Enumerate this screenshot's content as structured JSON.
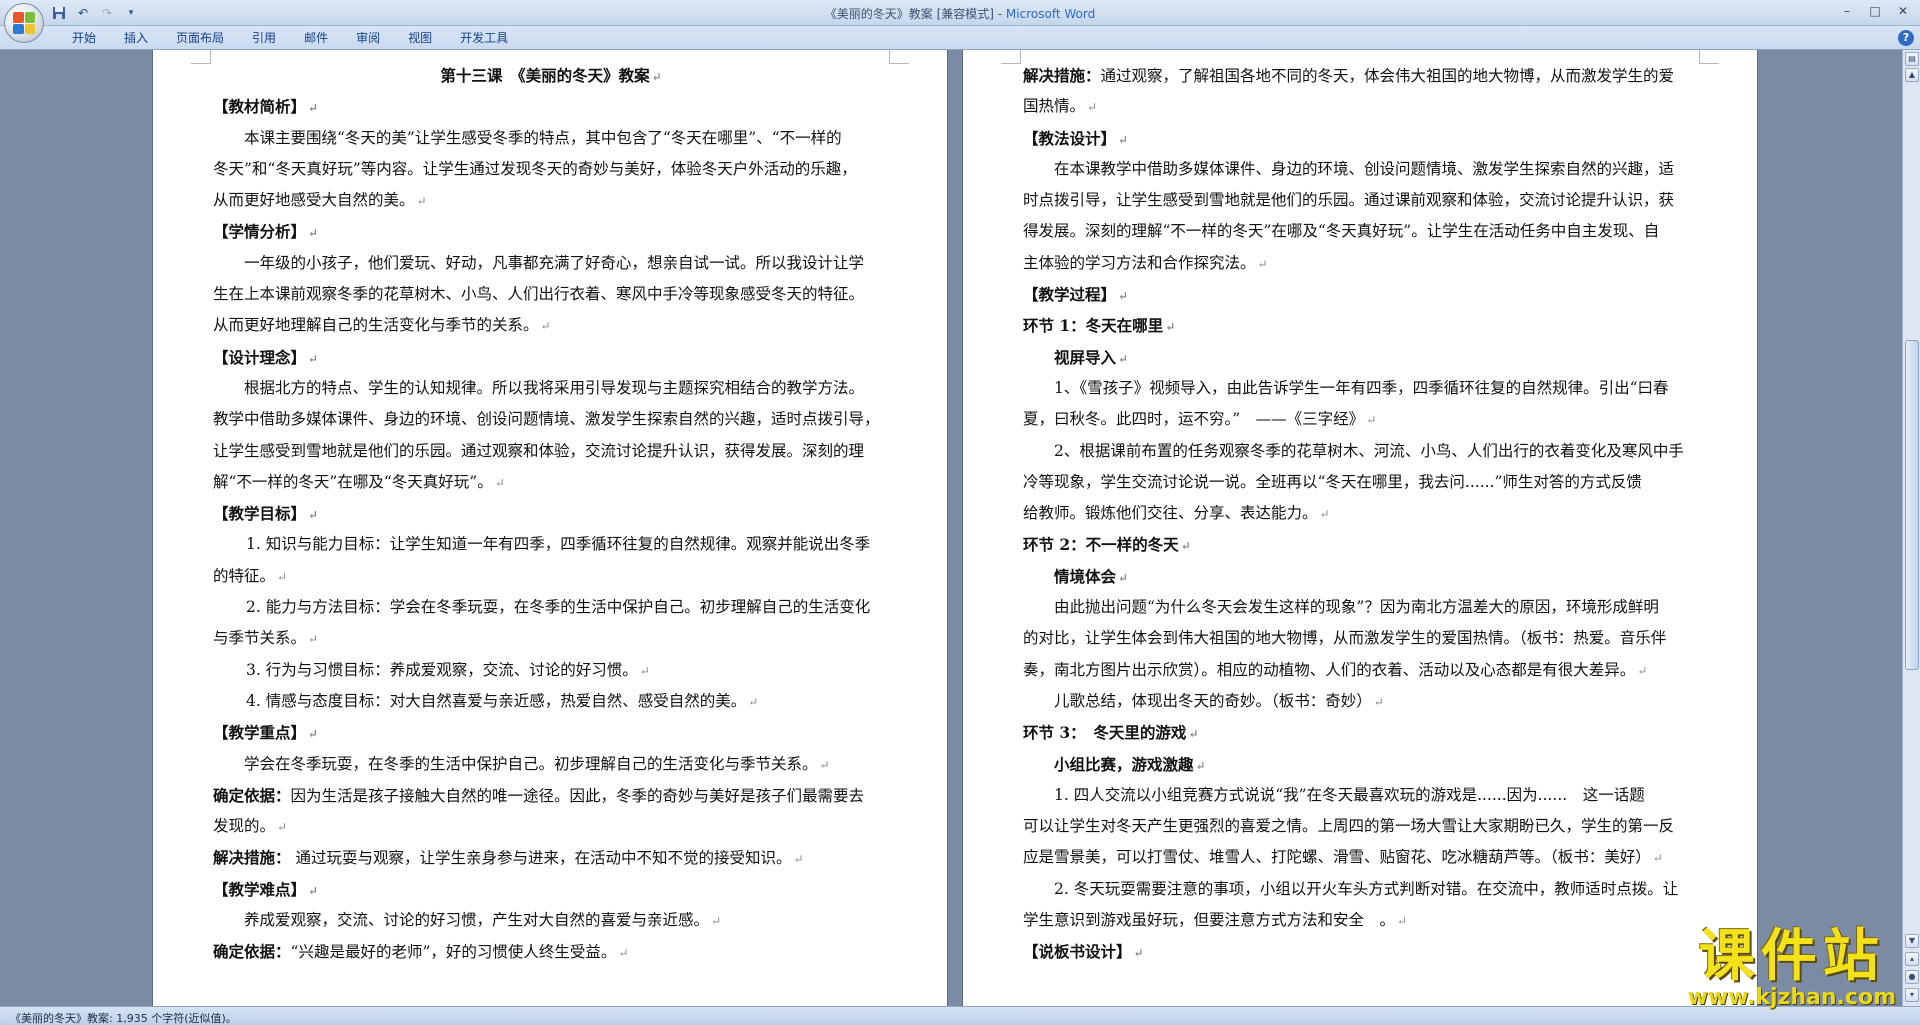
{
  "window": {
    "title": "《美丽的冬天》教案 [兼容模式] - ",
    "app_name": "Microsoft Word",
    "controls": [
      "–",
      "□",
      "✕"
    ]
  },
  "qat": {
    "icons": [
      "save-icon",
      "undo-icon",
      "redo-icon",
      "customize-icon"
    ]
  },
  "ribbon": {
    "tabs": [
      "开始",
      "插入",
      "页面布局",
      "引用",
      "邮件",
      "审阅",
      "视图",
      "开发工具"
    ],
    "help": "?"
  },
  "status": {
    "text": "《美丽的冬天》教案: 1,935 个字符(近似值)。"
  },
  "watermark": {
    "main": "课件站",
    "url": "www.kjzhan.com"
  },
  "page1": {
    "lines": [
      "第十三课　《美丽的冬天》教案",
      "【教材简析】",
      "本课主要围绕“冬天的美”让学生感受冬季的特点，其中包含了“冬天在哪里”、“不一样的",
      "冬天”和“冬天真好玩”等内容。让学生通过发现冬天的奇妙与美好，体验冬天户外活动的乐趣，",
      "从而更好地感受大自然的美。",
      "【学情分析】",
      "一年级的小孩子，他们爱玩、好动，凡事都充满了好奇心，想亲自试一试。所以我设计让学",
      "生在上本课前观察冬季的花草树木、小鸟、人们出行衣着、寒风中手冷等现象感受冬天的特征。",
      "从而更好地理解自己的生活变化与季节的关系。",
      "【设计理念】",
      "根据北方的特点、学生的认知规律。所以我将采用引导发现与主题探究相结合的教学方法。",
      "教学中借助多媒体课件、身边的环境、创设问题情境、激发学生探索自然的兴趣，适时点拨引导，",
      "让学生感受到雪地就是他们的乐园。通过观察和体验，交流讨论提升认识，获得发展。深刻的理",
      "解“不一样的冬天”在哪及“冬天真好玩”。",
      "【教学目标】",
      "1. 知识与能力目标：让学生知道一年有四季，四季循环往复的自然规律。观察并能说出冬季",
      "的特征。",
      "2. 能力与方法目标：学会在冬季玩耍，在冬季的生活中保护自己。初步理解自己的生活变化",
      "与季节关系。",
      "3. 行为与习惯目标：养成爱观察，交流、讨论的好习惯。",
      "4. 情感与态度目标：对大自然喜爱与亲近感，热爱自然、感受自然的美。",
      "【教学重点】",
      "学会在冬季玩耍，在冬季的生活中保护自己。初步理解自己的生活变化与季节关系。",
      "确定依据：",
      "因为生活是孩子接触大自然的唯一途径。因此，冬季的奇妙与美好是孩子们最需要去",
      "发现的。",
      "解决措施：",
      " 通过玩耍与观察，让学生亲身参与进来，在活动中不知不觉的接受知识。",
      "【教学难点】",
      "养成爱观察，交流、讨论的好习惯，产生对大自然的喜爱与亲近感。",
      "确定依据：",
      "“兴趣是最好的老师”，好的习惯使人终生受益。"
    ]
  },
  "page2": {
    "lines": [
      "解决措施：",
      "通过观察，了解祖国各地不同的冬天，体会伟大祖国的地大物博，从而激发学生的爱",
      "国热情。",
      "【教法设计】",
      "在本课教学中借助多媒体课件、身边的环境、创设问题情境、激发学生探索自然的兴趣，适",
      "时点拨引导，让学生感受到雪地就是他们的乐园。通过课前观察和体验，交流讨论提升认识，获",
      "得发展。深刻的理解“不一样的冬天”在哪及“冬天真好玩”。让学生在活动任务中自主发现、自",
      "主体验的学习方法和合作探究法。",
      "【教学过程】",
      "环节 1：冬天在哪里",
      "视屏导入",
      "1、《雪孩子》视频导入，由此告诉学生一年有四季，四季循环往复的自然规律。引出“曰春",
      "夏，曰秋冬。此四时，运不穷。”　——《三字经》",
      "2、根据课前布置的任务观察冬季的花草树木、河流、小鸟、人们出行的衣着变化及寒风中手",
      "冷等现象，学生交流讨论说一说。全班再以“冬天在哪里，我去问......”师生对答的方式反馈",
      "给教师。锻炼他们交往、分享、表达能力。",
      "环节 2：不一样的冬天",
      "情境体会",
      "由此抛出问题“为什么冬天会发生这样的现象”？因为南北方温差大的原因，环境形成鲜明",
      "的对比，让学生体会到伟大祖国的地大物博，从而激发学生的爱国热情。（板书：热爱。音乐伴",
      "奏，南北方图片出示欣赏）。相应的动植物、人们的衣着、活动以及心态都是有很大差异。",
      "儿歌总结，体现出冬天的奇妙。（板书：奇妙）",
      "环节 3：　冬天里的游戏",
      "小组比赛，游戏激趣",
      "1. 四人交流以小组竞赛方式说说“我”在冬天最喜欢玩的游戏是......因为......　这一话题",
      "可以让学生对冬天产生更强烈的喜爱之情。上周四的第一场大雪让大家期盼已久，学生的第一反",
      "应是雪景美，可以打雪仗、堆雪人、打陀螺、滑雪、贴窗花、吃冰糖葫芦等。（板书：美好）",
      "2. 冬天玩耍需要注意的事项，小组以开火车头方式判断对错。在交流中，教师适时点拨。让",
      "学生意识到游戏虽好玩，但要注意方式方法和安全　。",
      "【说板书设计】"
    ]
  }
}
